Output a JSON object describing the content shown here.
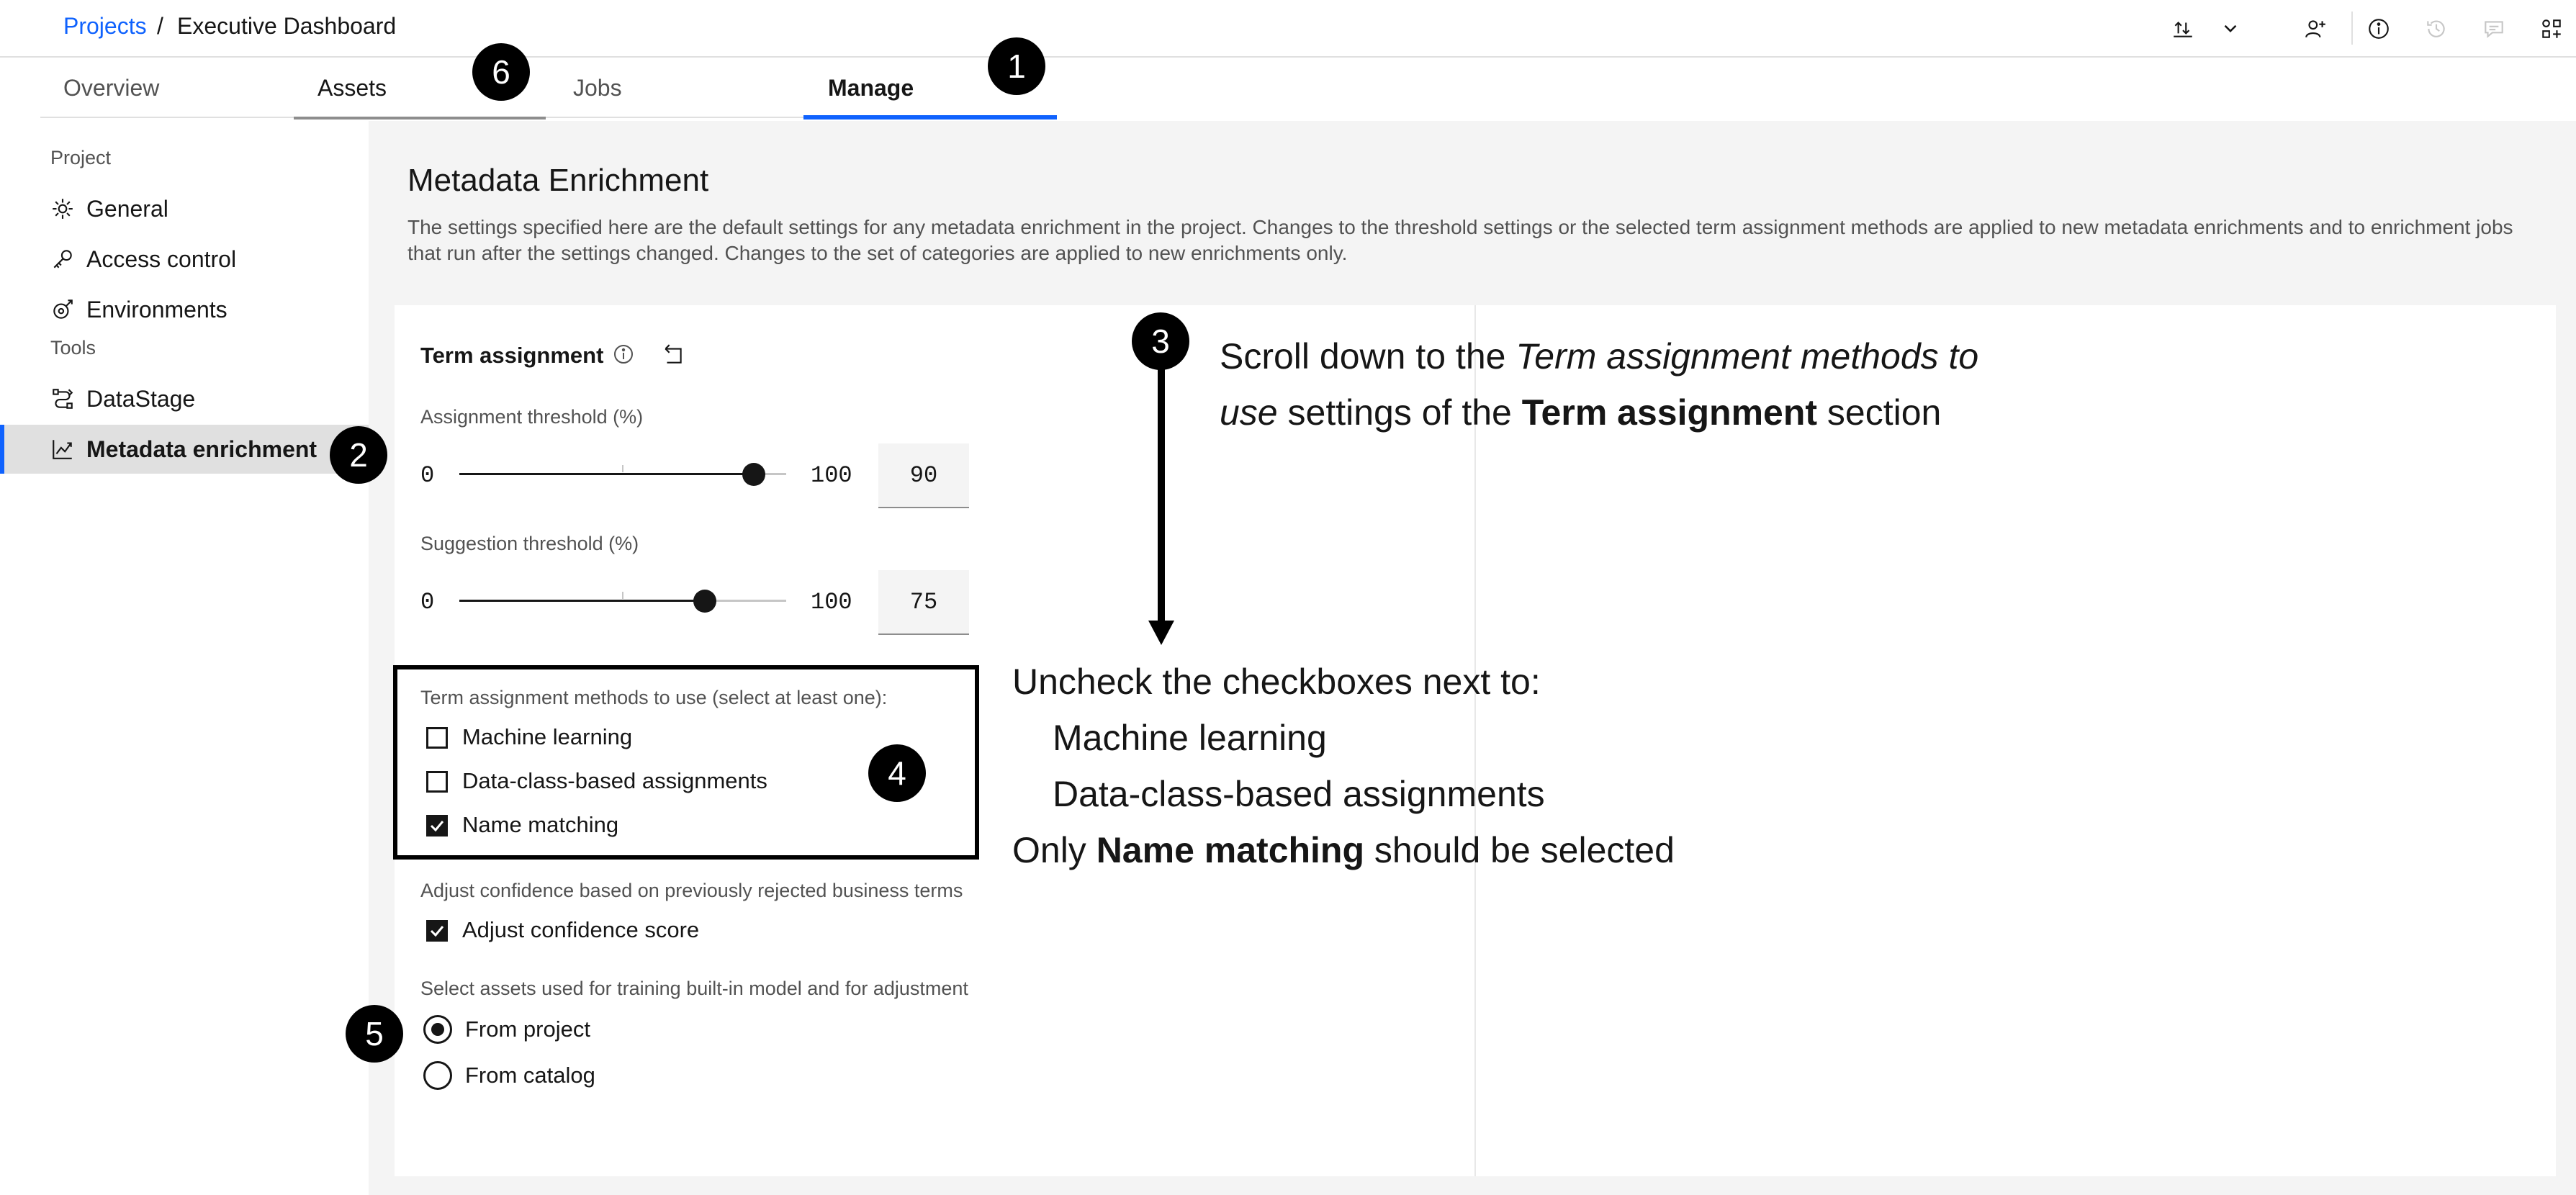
{
  "header": {
    "breadcrumb_root": "Projects",
    "breadcrumb_sep": "/",
    "breadcrumb_current": "Executive Dashboard",
    "icons": [
      "import-export-icon",
      "chevron-down-icon",
      "add-collaborator-icon",
      "info-icon",
      "history-icon",
      "comment-icon",
      "apps-icon"
    ]
  },
  "tabs": [
    {
      "label": "Overview"
    },
    {
      "label": "Assets"
    },
    {
      "label": "Jobs"
    },
    {
      "label": "Manage",
      "active": true
    }
  ],
  "sidebar": {
    "section_project": "Project",
    "section_tools": "Tools",
    "items": [
      {
        "label": "General",
        "icon": "gear-icon"
      },
      {
        "label": "Access control",
        "icon": "key-icon"
      },
      {
        "label": "Environments",
        "icon": "environment-icon"
      },
      {
        "label": "DataStage",
        "icon": "datastage-icon"
      },
      {
        "label": "Metadata enrichment",
        "icon": "enrichment-icon",
        "active": true
      }
    ]
  },
  "main": {
    "title": "Metadata Enrichment",
    "description": "The settings specified here are the default settings for any metadata enrichment in the project. Changes to the threshold settings or the selected term assignment methods are applied to new metadata enrichments and to enrichment jobs that run after the settings changed. Changes to the set of categories are applied to new enrichments only.",
    "section_title": "Term assignment",
    "assignment_threshold": {
      "label": "Assignment threshold (%)",
      "min": "0",
      "max": "100",
      "value": "90",
      "level": 0.9
    },
    "suggestion_threshold": {
      "label": "Suggestion threshold (%)",
      "min": "0",
      "max": "100",
      "value": "75",
      "level": 0.75
    },
    "methods": {
      "label": "Term assignment methods to use (select at least one):",
      "options": [
        {
          "label": "Machine learning",
          "checked": false
        },
        {
          "label": "Data-class-based assignments",
          "checked": false
        },
        {
          "label": "Name matching",
          "checked": true
        }
      ]
    },
    "confidence": {
      "label": "Adjust confidence based on previously rejected business terms",
      "option": "Adjust confidence score",
      "checked": true
    },
    "training": {
      "label": "Select assets used for training built-in model and for adjustment",
      "options": [
        {
          "label": "From project",
          "selected": true
        },
        {
          "label": "From catalog",
          "selected": false
        }
      ]
    }
  },
  "annotations": {
    "badges": [
      "1",
      "2",
      "3",
      "4",
      "5",
      "6"
    ],
    "step3_line1_prefix": "Scroll down to the ",
    "step3_line1_italic": "Term assignment methods to",
    "step3_line2_italic": "use",
    "step3_line2_mid": " settings of the ",
    "step3_line2_bold": "Term assignment",
    "step3_line2_suffix": " section",
    "step4_line1": "Uncheck the checkboxes next to:",
    "step4_line2": "Machine learning",
    "step4_line3": "Data-class-based assignments",
    "step4_line4_prefix": "Only ",
    "step4_line4_bold": "Name matching",
    "step4_line4_suffix": " should be selected"
  }
}
